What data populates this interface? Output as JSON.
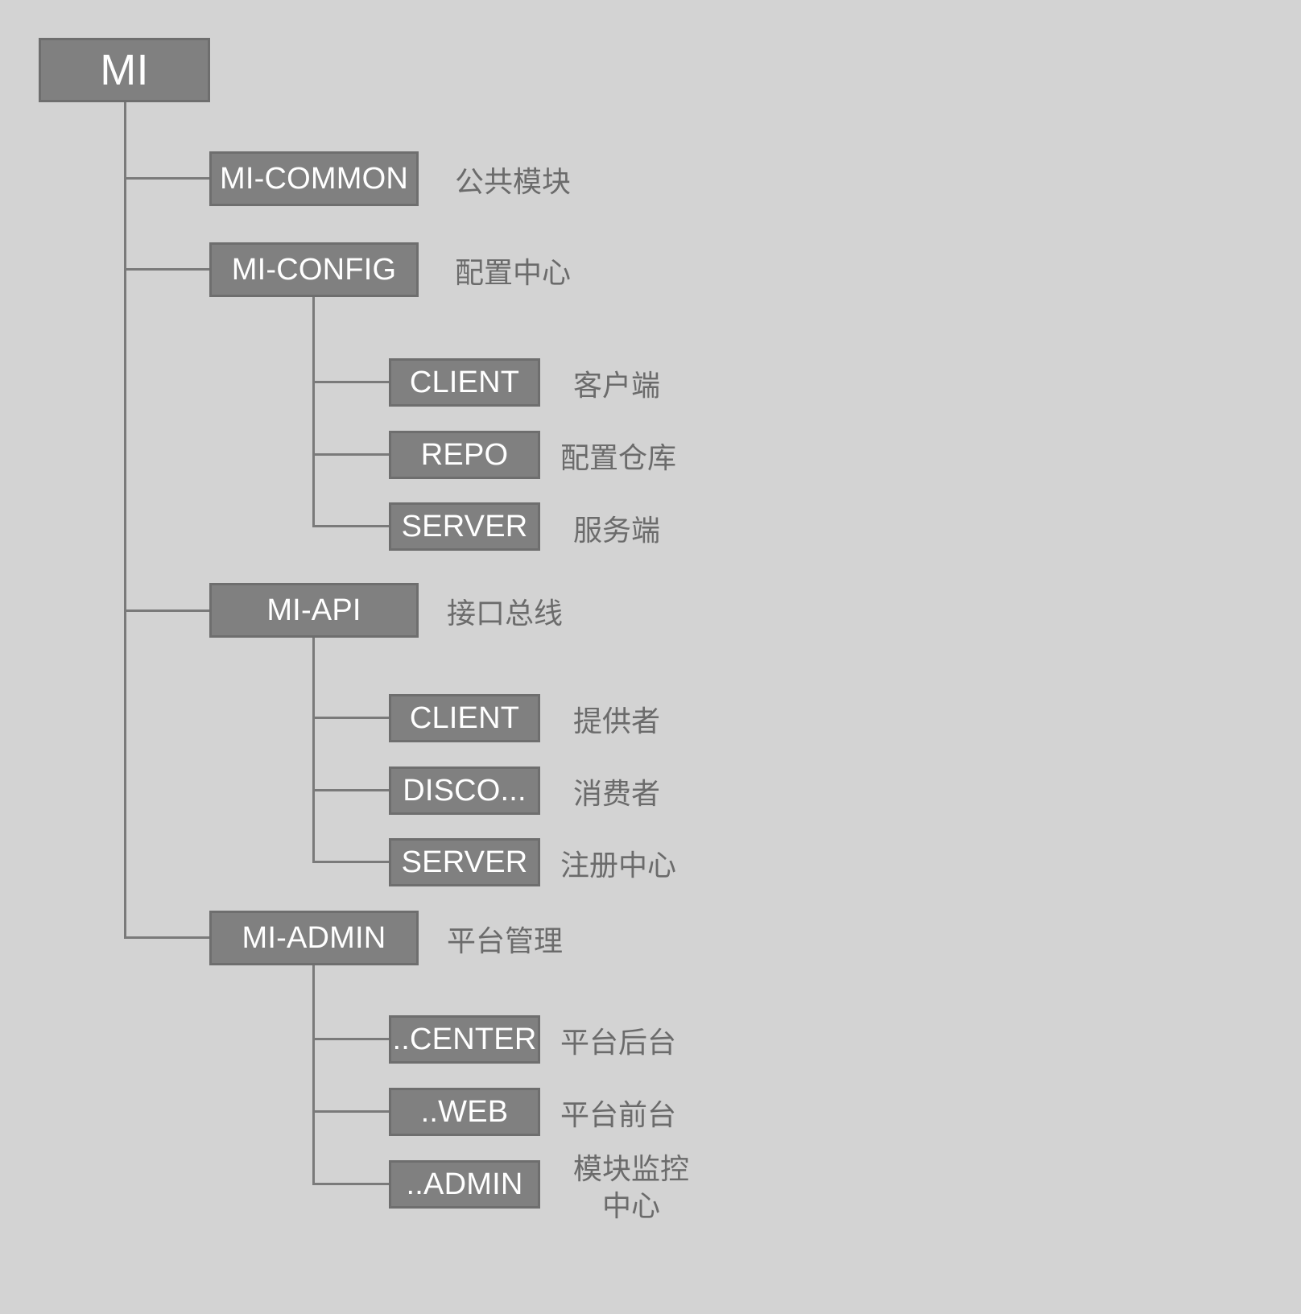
{
  "diagram": {
    "title": "MI",
    "background_color": "#d3d3d3",
    "box_fill_color": "#808080",
    "box_border_color": "#6e6e6e",
    "box_text_color": "#ffffff",
    "line_color": "#7a7a7a",
    "note_text_color": "#6b6b6b"
  },
  "root": {
    "label": "MI"
  },
  "level1": [
    {
      "label": "MI-COMMON",
      "note": "公共模块"
    },
    {
      "label": "MI-CONFIG",
      "note": "配置中心"
    },
    {
      "label": "MI-API",
      "note": "接口总线"
    },
    {
      "label": "MI-ADMIN",
      "note": "平台管理"
    }
  ],
  "config_children": [
    {
      "label": "CLIENT",
      "note": "客户端"
    },
    {
      "label": "REPO",
      "note": "配置仓库"
    },
    {
      "label": "SERVER",
      "note": "服务端"
    }
  ],
  "api_children": [
    {
      "label": "CLIENT",
      "note": "提供者"
    },
    {
      "label": "DISCO...",
      "note": "消费者"
    },
    {
      "label": "SERVER",
      "note": "注册中心"
    }
  ],
  "admin_children": [
    {
      "label": "..CENTER",
      "note": "平台后台"
    },
    {
      "label": "..WEB",
      "note": "平台前台"
    },
    {
      "label": "..ADMIN",
      "note": "模块监控\n中心"
    }
  ]
}
